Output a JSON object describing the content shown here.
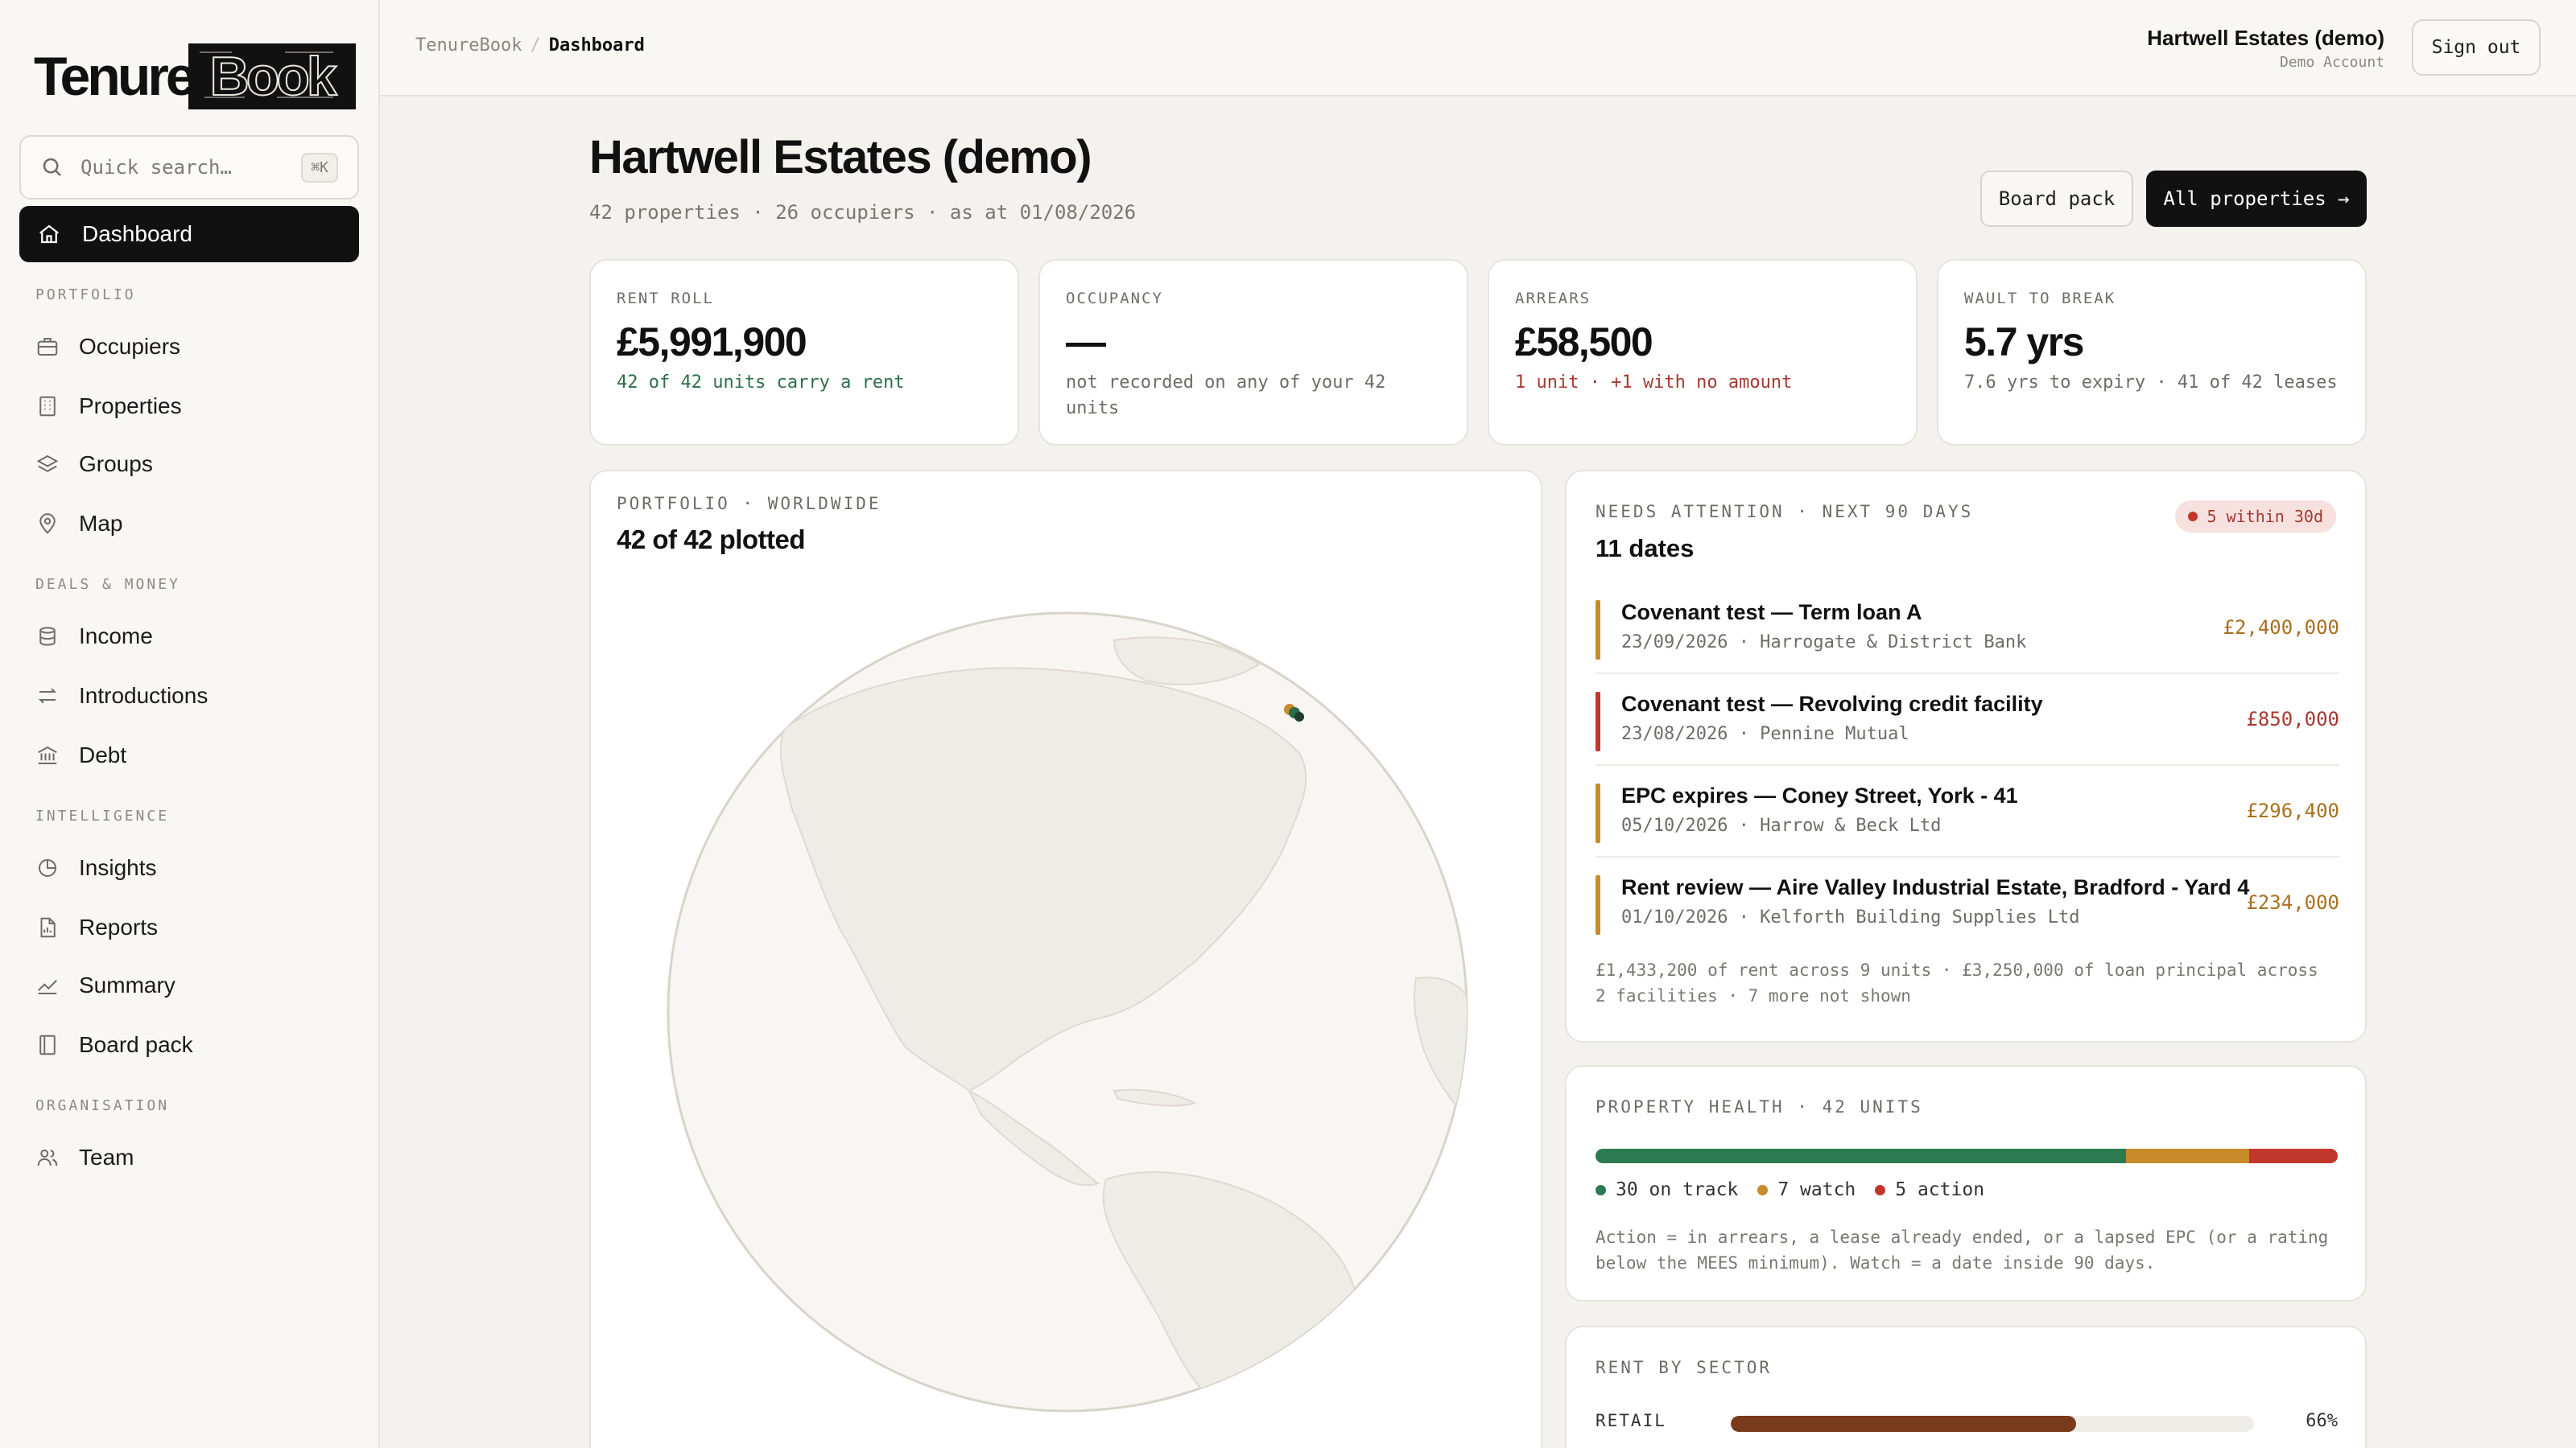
{
  "brand": {
    "logo_left": "Tenure",
    "logo_right": "Book"
  },
  "search": {
    "placeholder": "Quick search…",
    "shortcut": "⌘K"
  },
  "nav": {
    "active": {
      "label": "Dashboard",
      "icon": "home-icon"
    },
    "sections": [
      {
        "title": "PORTFOLIO",
        "items": [
          {
            "label": "Occupiers",
            "icon": "briefcase-icon"
          },
          {
            "label": "Properties",
            "icon": "building-icon"
          },
          {
            "label": "Groups",
            "icon": "layers-icon"
          },
          {
            "label": "Map",
            "icon": "map-pin-icon"
          }
        ]
      },
      {
        "title": "DEALS & MONEY",
        "items": [
          {
            "label": "Income",
            "icon": "database-icon"
          },
          {
            "label": "Introductions",
            "icon": "arrows-exchange-icon"
          },
          {
            "label": "Debt",
            "icon": "bank-icon"
          }
        ]
      },
      {
        "title": "INTELLIGENCE",
        "items": [
          {
            "label": "Insights",
            "icon": "pie-chart-icon"
          },
          {
            "label": "Reports",
            "icon": "report-icon"
          },
          {
            "label": "Summary",
            "icon": "trend-line-icon"
          },
          {
            "label": "Board pack",
            "icon": "book-icon"
          }
        ]
      },
      {
        "title": "ORGANISATION",
        "items": [
          {
            "label": "Team",
            "icon": "users-icon"
          }
        ]
      }
    ]
  },
  "topbar": {
    "breadcrumb_root": "TenureBook",
    "breadcrumb_sep": "/",
    "breadcrumb_current": "Dashboard",
    "account_name": "Hartwell Estates (demo)",
    "account_sub": "Demo Account",
    "sign_out": "Sign out"
  },
  "header": {
    "title": "Hartwell Estates (demo)",
    "subtitle": "42 properties · 26 occupiers · as at 01/08/2026",
    "board_pack": "Board pack",
    "all_properties": "All properties →"
  },
  "kpis": [
    {
      "label": "RENT ROLL",
      "value": "£5,991,900",
      "note": "42 of 42 units carry a rent",
      "note_color": "#2f6f4a"
    },
    {
      "label": "OCCUPANCY",
      "value": "—",
      "note": "not recorded on any of your 42 units",
      "note_color": "#6f6c65"
    },
    {
      "label": "ARREARS",
      "value": "£58,500",
      "note": "1 unit · +1 with no amount",
      "note_color": "#a43a31"
    },
    {
      "label": "WAULT TO BREAK",
      "value": "5.7 yrs",
      "note": "7.6 yrs to expiry · 41 of 42 leases",
      "note_color": "#6f6c65"
    }
  ],
  "map": {
    "label": "PORTFOLIO · WORLDWIDE",
    "title": "42 of 42 plotted",
    "marker_colors": [
      "#c98a2a",
      "#2a6b4b",
      "#1f3b2b"
    ]
  },
  "attention": {
    "label": "NEEDS ATTENTION · NEXT 90 DAYS",
    "title": "11 dates",
    "pill": "5 within 30d",
    "items": [
      {
        "title": "Covenant test — Term loan A",
        "sub": "23/09/2026 · Harrogate & District Bank",
        "amount": "£2,400,000",
        "color": "#c98a2a"
      },
      {
        "title": "Covenant test — Revolving credit facility",
        "sub": "23/08/2026 · Pennine Mutual",
        "amount": "£850,000",
        "color": "#c2372b"
      },
      {
        "title": "EPC expires — Coney Street, York - 41",
        "sub": "05/10/2026 · Harrow & Beck Ltd",
        "amount": "£296,400",
        "color": "#c98a2a"
      },
      {
        "title": "Rent review — Aire Valley Industrial Estate, Bradford - Yard 4",
        "sub": "01/10/2026 · Kelforth Building Supplies Ltd",
        "amount": "£234,000",
        "color": "#c98a2a"
      }
    ],
    "footer": "£1,433,200 of rent across 9 units · £3,250,000 of loan principal across 2 facilities · 7 more not shown"
  },
  "health": {
    "label": "PROPERTY HEALTH · 42 UNITS",
    "segments": [
      {
        "label": "30 on track",
        "count": 30,
        "color": "#2c7a4f"
      },
      {
        "label": "7 watch",
        "count": 7,
        "color": "#c98a2a"
      },
      {
        "label": "5 action",
        "count": 5,
        "color": "#c2372b"
      }
    ],
    "note": "Action = in arrears, a lease already ended, or a lapsed EPC (or a rating below the MEES minimum). Watch = a date inside 90 days."
  },
  "sector": {
    "label": "RENT BY SECTOR",
    "rows": [
      {
        "name": "RETAIL",
        "percent": 66,
        "percent_label": "66%",
        "color": "#7a3a1c"
      }
    ]
  }
}
